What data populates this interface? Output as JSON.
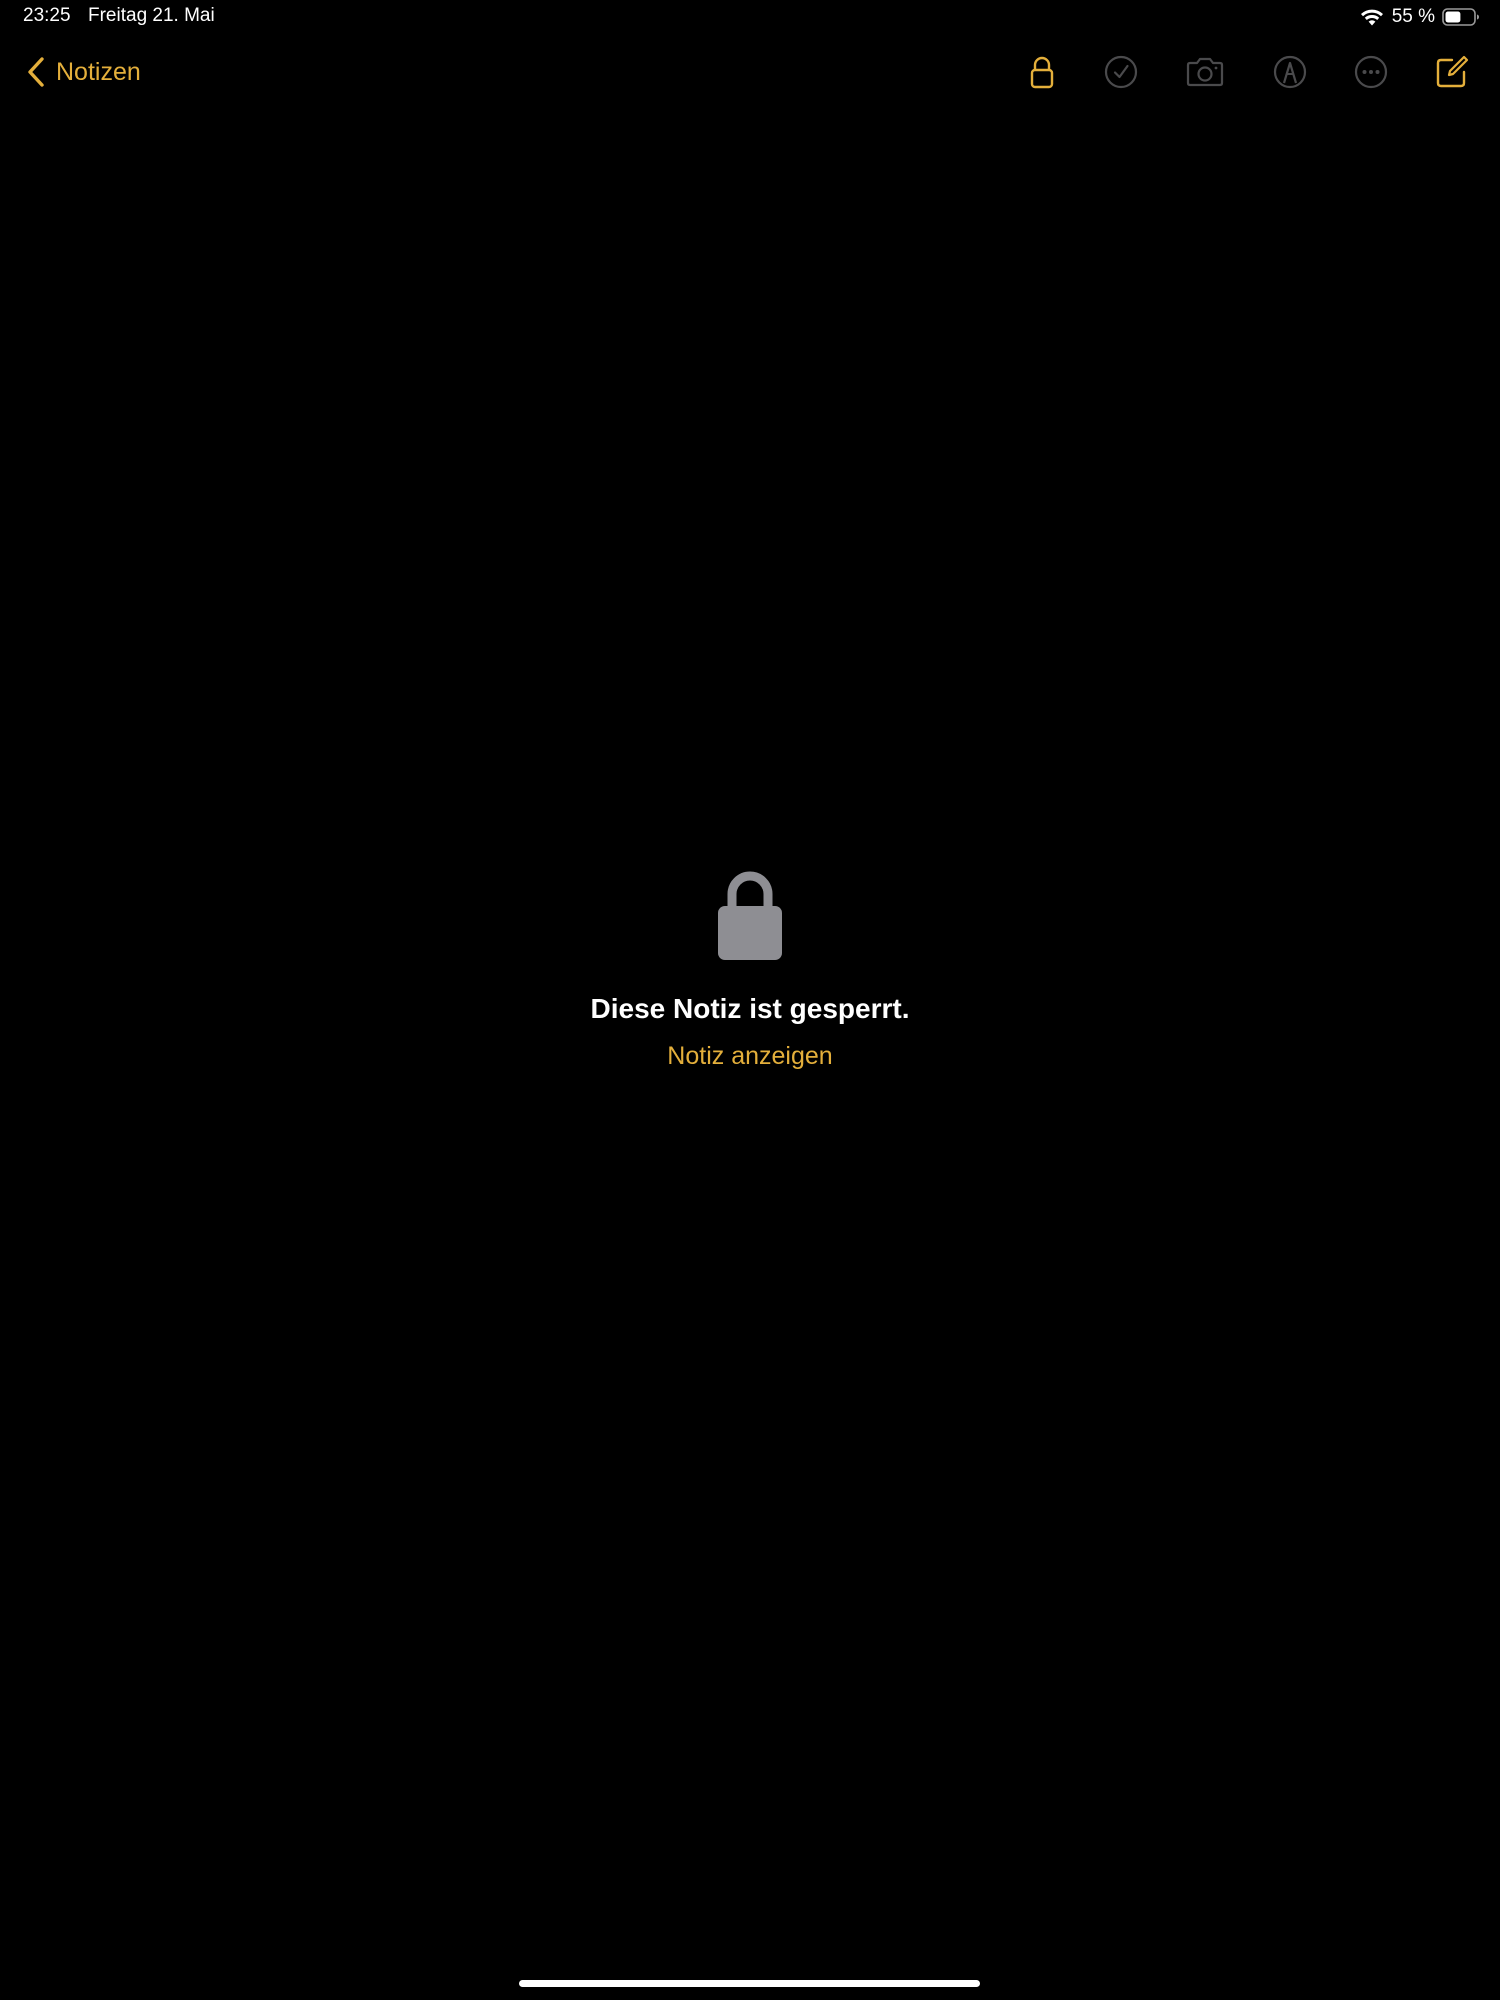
{
  "status_bar": {
    "time": "23:25",
    "date": "Freitag 21. Mai",
    "battery_percent": "55 %",
    "battery_level": 0.55,
    "icons": [
      "wifi-icon",
      "battery-icon"
    ]
  },
  "nav": {
    "back_label": "Notizen",
    "toolbar_icons": [
      "lock-icon",
      "checklist-icon",
      "camera-icon",
      "markup-pen-icon",
      "more-ellipsis-icon",
      "compose-icon"
    ]
  },
  "locked": {
    "icon": "lock-icon",
    "title": "Diese Notiz ist gesperrt.",
    "action_label": "Notiz anzeigen"
  },
  "colors": {
    "background": "#000000",
    "accent": "#e4af3b",
    "disabled_icon": "#4a4a4c",
    "lock_gray": "#8e8e93",
    "text": "#ffffff"
  }
}
